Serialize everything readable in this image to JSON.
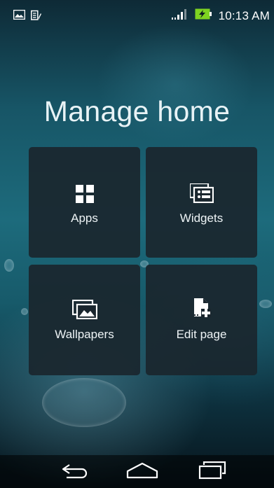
{
  "status_bar": {
    "time": "10:13 AM",
    "left_icons": [
      "image-notification-icon",
      "clipboard-notification-icon"
    ],
    "right_icons": [
      "signal-icon",
      "battery-charging-icon"
    ]
  },
  "title": "Manage home",
  "tiles": [
    {
      "label": "Apps",
      "icon": "apps-grid-icon"
    },
    {
      "label": "Widgets",
      "icon": "widgets-icon"
    },
    {
      "label": "Wallpapers",
      "icon": "wallpapers-icon"
    },
    {
      "label": "Edit page",
      "icon": "edit-page-icon"
    }
  ],
  "nav_bar": {
    "buttons": [
      "back-icon",
      "home-icon",
      "recent-apps-icon"
    ]
  },
  "colors": {
    "tile_background": "#1a262e",
    "battery_green": "#7ed321",
    "title_text": "#e8f3f6"
  }
}
